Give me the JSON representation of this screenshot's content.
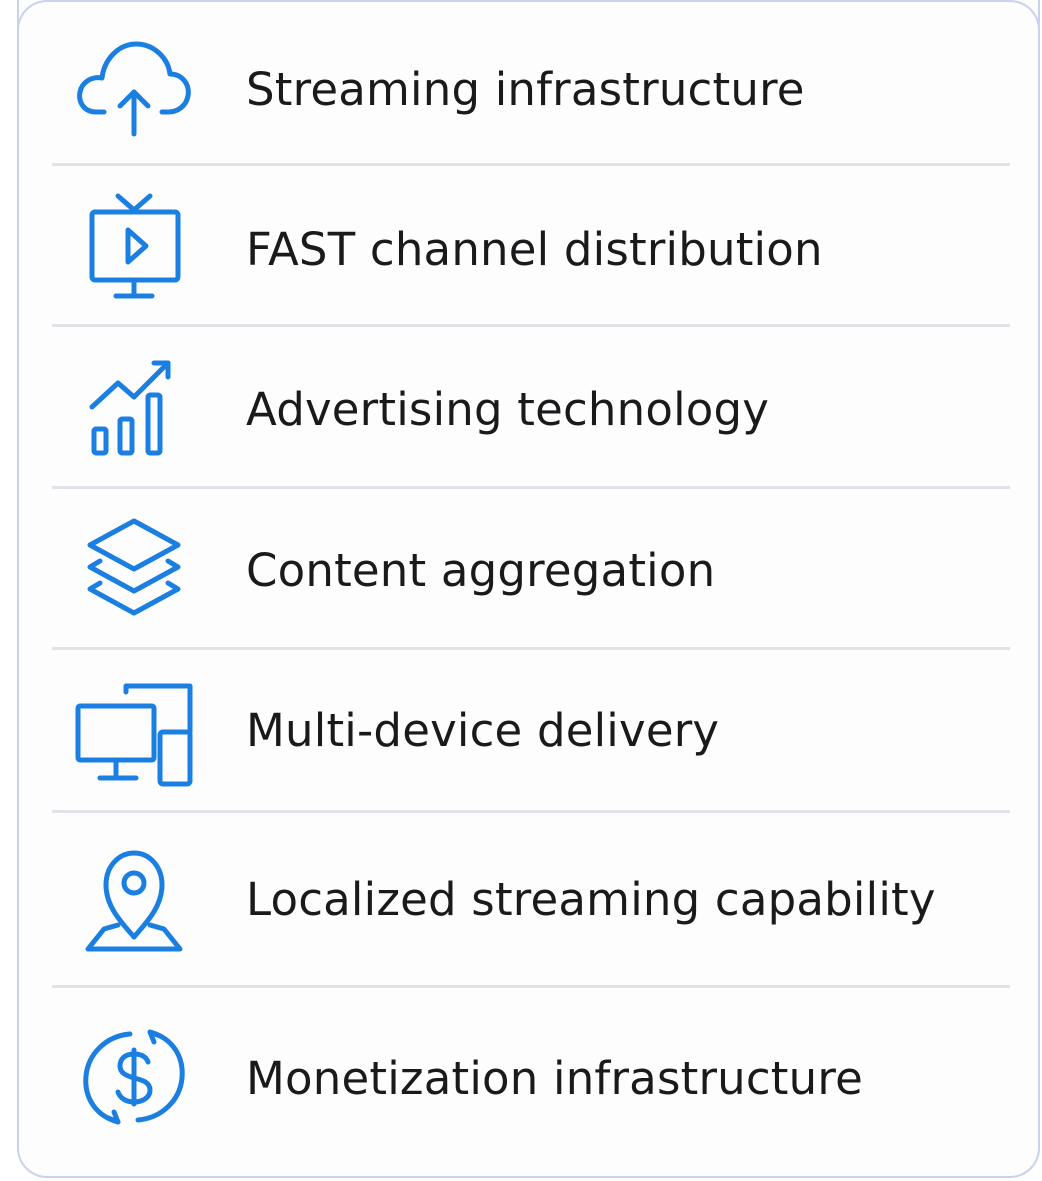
{
  "accent_color": "#1a7fe0",
  "items": [
    {
      "label": "Streaming infrastructure",
      "icon": "cloud-upload-icon"
    },
    {
      "label": "FAST channel distribution",
      "icon": "tv-play-icon"
    },
    {
      "label": "Advertising technology",
      "icon": "growth-chart-icon"
    },
    {
      "label": "Content aggregation",
      "icon": "layers-icon"
    },
    {
      "label": "Multi-device delivery",
      "icon": "devices-icon"
    },
    {
      "label": "Localized streaming capability",
      "icon": "location-pin-icon"
    },
    {
      "label": "Monetization infrastructure",
      "icon": "dollar-cycle-icon"
    }
  ]
}
